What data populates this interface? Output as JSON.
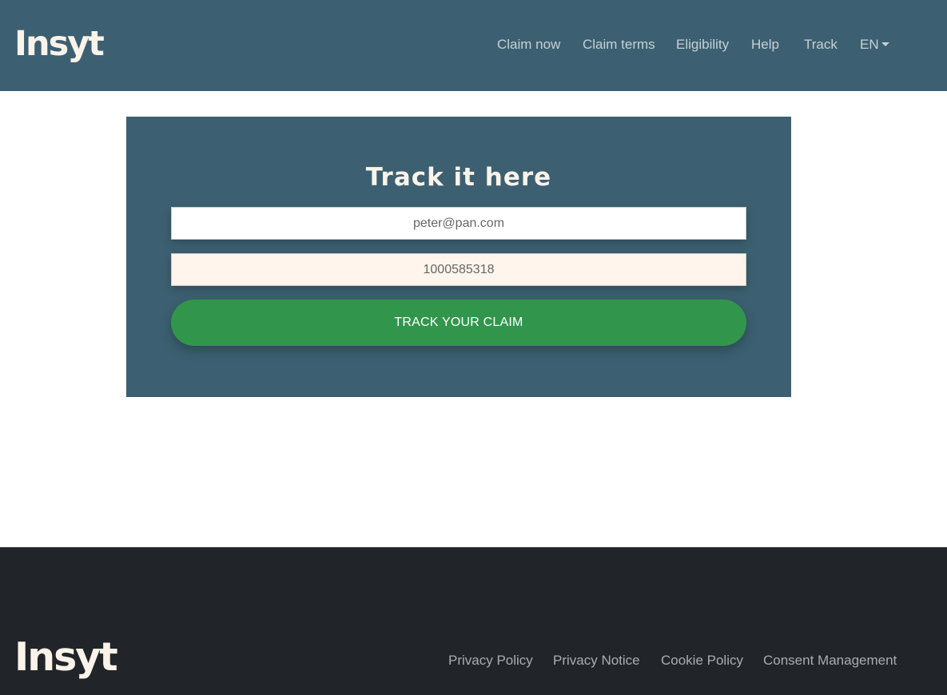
{
  "header": {
    "logo": "Insyt",
    "nav": [
      {
        "label": "Claim now"
      },
      {
        "label": "Claim terms"
      },
      {
        "label": "Eligibility"
      },
      {
        "label": "Help"
      },
      {
        "label": "Track"
      }
    ],
    "language": "EN"
  },
  "track_form": {
    "title": "Track it here",
    "email_value": "peter@pan.com",
    "claim_number_value": "1000585318",
    "submit_label": "TRACK YOUR CLAIM"
  },
  "footer": {
    "logo": "Insyt",
    "links": [
      {
        "label": "Privacy Policy"
      },
      {
        "label": "Privacy Notice"
      },
      {
        "label": "Cookie Policy"
      },
      {
        "label": "Consent Management"
      }
    ]
  },
  "colors": {
    "header_bg": "#3c6071",
    "footer_bg": "#212429",
    "button_green": "#31964c",
    "logo_cream": "#fbf3ea"
  },
  "icons": {
    "language_dropdown": "caret-down-icon"
  }
}
